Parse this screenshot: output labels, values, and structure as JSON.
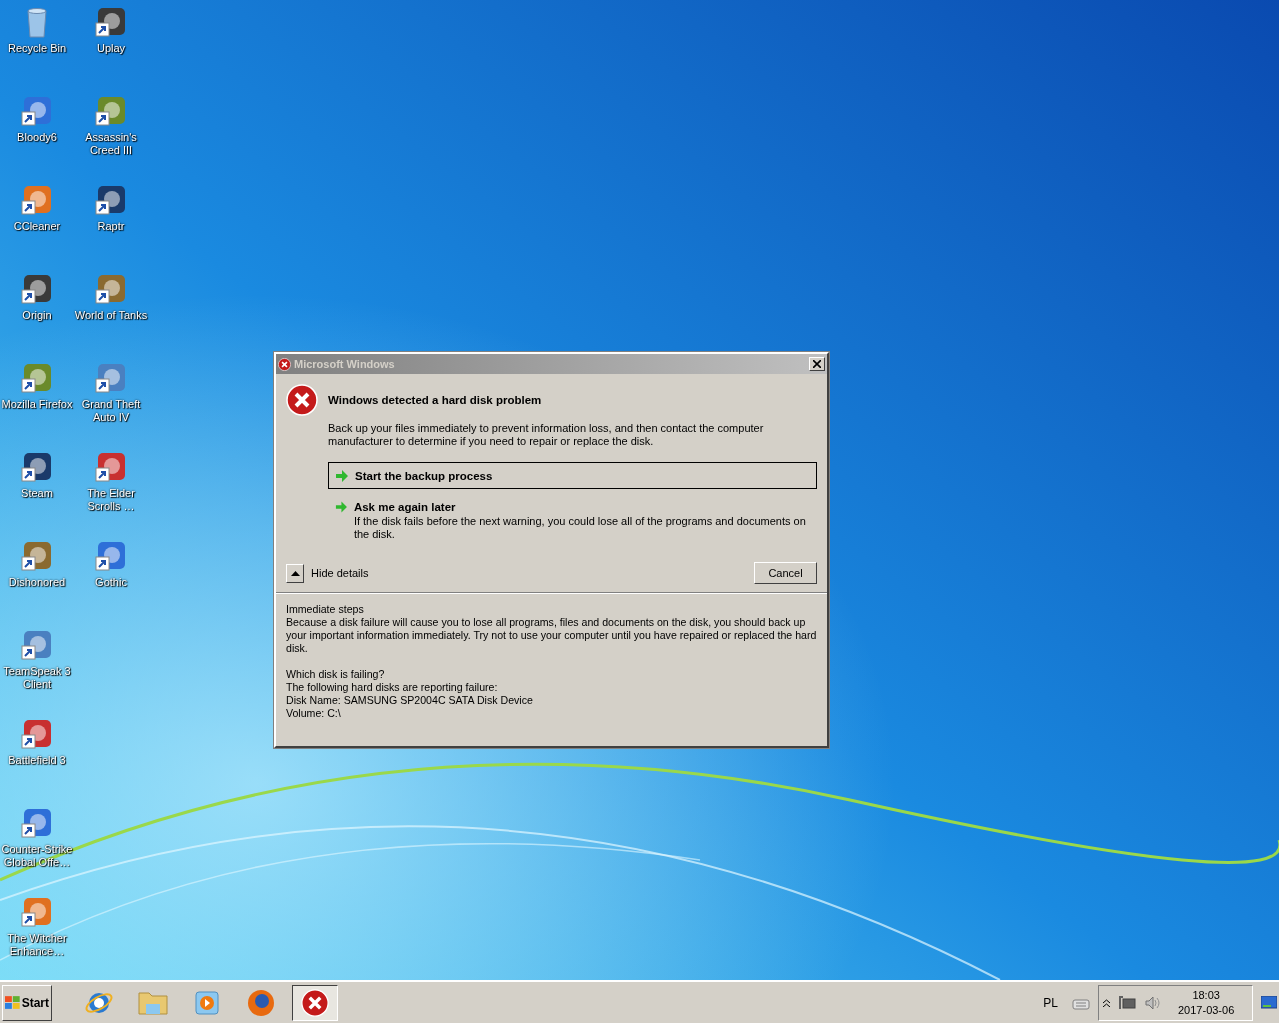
{
  "desktop": {
    "columns": [
      [
        {
          "label": "Recycle Bin",
          "shortcut": false
        },
        {
          "label": "Bloody6",
          "shortcut": true
        },
        {
          "label": "CCleaner",
          "shortcut": true
        },
        {
          "label": "Origin",
          "shortcut": true
        },
        {
          "label": "Mozilla Firefox",
          "shortcut": true
        },
        {
          "label": "Steam",
          "shortcut": true
        },
        {
          "label": "Dishonored",
          "shortcut": true
        },
        {
          "label": "TeamSpeak 3 Client",
          "shortcut": true
        },
        {
          "label": "Battlefield 3",
          "shortcut": true
        },
        {
          "label": "Counter-Strike Global Offe…",
          "shortcut": true
        },
        {
          "label": "The Witcher Enhance…",
          "shortcut": true
        }
      ],
      [
        {
          "label": "Uplay",
          "shortcut": true
        },
        {
          "label": "Assassin's Creed III",
          "shortcut": true
        },
        {
          "label": "Raptr",
          "shortcut": true
        },
        {
          "label": "World of Tanks",
          "shortcut": true
        },
        {
          "label": "Grand Theft Auto IV",
          "shortcut": true
        },
        {
          "label": "The Elder Scrolls …",
          "shortcut": true
        },
        {
          "label": "Gothic",
          "shortcut": true
        }
      ]
    ]
  },
  "dialog": {
    "title": "Microsoft Windows",
    "heading": "Windows detected a hard disk problem",
    "message": "Back up your files immediately to prevent information loss, and then contact the computer manufacturer to determine if you need to repair or replace the disk.",
    "options": [
      {
        "label": "Start the backup process",
        "selected": true
      },
      {
        "label": "Ask me again later",
        "description": "If the disk fails before the next warning, you could lose all of the programs and documents on the disk.",
        "selected": false
      }
    ],
    "details_toggle": {
      "label": "Hide details",
      "expanded": true
    },
    "cancel_button": "Cancel",
    "details": [
      [
        "Immediate steps",
        "Because a disk failure will cause you to lose all programs, files and documents on the disk, you should back up your important information immediately.  Try not to use your computer until you have repaired or replaced the hard disk."
      ],
      [
        "Which disk is failing?",
        "The following hard disks are reporting failure:",
        "Disk Name: SAMSUNG SP2004C SATA Disk Device",
        "Volume: C:\\"
      ]
    ]
  },
  "taskbar": {
    "start": "Start",
    "items": [
      {
        "kind": "browser",
        "active": false
      },
      {
        "kind": "folder",
        "active": false
      },
      {
        "kind": "media",
        "active": false
      },
      {
        "kind": "firefox",
        "active": false
      },
      {
        "kind": "error",
        "active": true
      }
    ],
    "language": "PL",
    "time": "18:03",
    "date": "2017-03-06"
  }
}
